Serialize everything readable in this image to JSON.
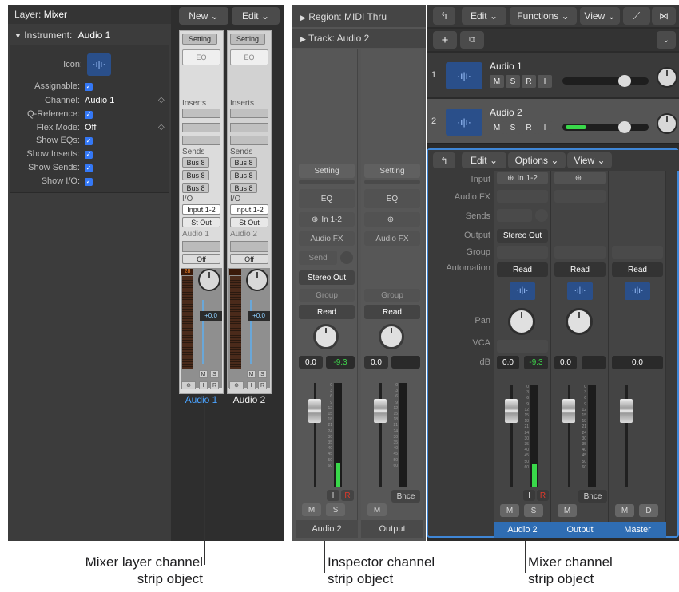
{
  "inspector_left": {
    "layer_label": "Layer:",
    "layer_value": "Mixer",
    "instrument_label": "Instrument:",
    "instrument_value": "Audio 1",
    "icon_label": "Icon:",
    "props": [
      {
        "label": "Assignable:",
        "value": "✓"
      },
      {
        "label": "Channel:",
        "value": "Audio 1"
      },
      {
        "label": "Q-Reference:",
        "value": "✓"
      },
      {
        "label": "Flex Mode:",
        "value": "Off"
      },
      {
        "label": "Show EQs:",
        "value": "✓"
      },
      {
        "label": "Show Inserts:",
        "value": "✓"
      },
      {
        "label": "Show Sends:",
        "value": "✓"
      },
      {
        "label": "Show I/O:",
        "value": "✓"
      }
    ]
  },
  "env_toolbar": {
    "new": "New",
    "edit": "Edit"
  },
  "env_strips": [
    {
      "setting": "Setting",
      "eq": "EQ",
      "inserts": "Inserts",
      "sends": "Sends",
      "bus": [
        "Bus 8",
        "Bus 8",
        "Bus 8"
      ],
      "io": "I/O",
      "input": "Input 1-2",
      "output": "St Out",
      "name_small": "Audio 1",
      "off": "Off",
      "peak": "28",
      "vol": "+0.0",
      "name": "Audio 1"
    },
    {
      "setting": "Setting",
      "eq": "EQ",
      "inserts": "Inserts",
      "sends": "Sends",
      "bus": [
        "Bus 8",
        "Bus 8",
        "Bus 8"
      ],
      "io": "I/O",
      "input": "Input 1-2",
      "output": "St Out",
      "name_small": "Audio 2",
      "off": "Off",
      "peak": "",
      "vol": "+0.0",
      "name": "Audio 2"
    }
  ],
  "env_small_buttons": [
    "M",
    "S",
    "I",
    "R"
  ],
  "inspector_right": {
    "region_label": "Region:",
    "region_value": "MIDI Thru",
    "track_label": "Track:",
    "track_value": "Audio 2",
    "strips": [
      {
        "setting": "Setting",
        "eq": "EQ",
        "input": "In 1-2",
        "audiofx": "Audio FX",
        "send": "Send",
        "output": "Stereo Out",
        "group": "Group",
        "read": "Read",
        "vol": "0.0",
        "peak": "-9.3",
        "i": "I",
        "r": "R",
        "m": "M",
        "s": "S",
        "name": "Audio 2"
      },
      {
        "setting": "Setting",
        "eq": "EQ",
        "input": "",
        "audiofx": "Audio FX",
        "send": "",
        "output": "",
        "group": "Group",
        "read": "Read",
        "vol": "0.0",
        "peak": "",
        "i": "",
        "r": "",
        "m": "M",
        "s": "",
        "bnce": "Bnce",
        "name": "Output"
      }
    ]
  },
  "main_toolbar": {
    "edit": "Edit",
    "functions": "Functions",
    "view": "View"
  },
  "tracks": [
    {
      "num": "1",
      "name": "Audio 1",
      "btns": [
        "M",
        "S",
        "R",
        "I"
      ]
    },
    {
      "num": "2",
      "name": "Audio 2",
      "btns": [
        "M",
        "S",
        "R",
        "I"
      ]
    }
  ],
  "mixer": {
    "menus": {
      "edit": "Edit",
      "options": "Options",
      "view": "View"
    },
    "row_labels": [
      "Input",
      "Audio FX",
      "Sends",
      "Output",
      "Group",
      "Automation",
      "Pan",
      "VCA",
      "dB"
    ],
    "strips": [
      {
        "input": "In 1-2",
        "output": "Stereo Out",
        "read": "Read",
        "vol": "0.0",
        "peak": "-9.3",
        "i": "I",
        "r": "R",
        "m": "M",
        "s": "S",
        "name": "Audio 2"
      },
      {
        "input": "",
        "output": "",
        "read": "Read",
        "vol": "0.0",
        "peak": "",
        "bnce": "Bnce",
        "m": "M",
        "name": "Output"
      },
      {
        "read": "Read",
        "vol": "0.0",
        "m": "M",
        "d": "D",
        "name": "Master"
      }
    ]
  },
  "scale_ticks": [
    "0",
    "3",
    "6",
    "9",
    "12",
    "15",
    "18",
    "21",
    "24",
    "30",
    "35",
    "40",
    "45",
    "50",
    "60"
  ],
  "captions": {
    "left": [
      "Mixer layer channel",
      "strip object"
    ],
    "mid": [
      "Inspector channel",
      "strip object"
    ],
    "right": [
      "Mixer channel",
      "strip object"
    ]
  },
  "colors": {
    "accent": "#3478f6",
    "meter_green": "#39d84a",
    "peak_red": "#e0392b",
    "selected_strip": "#2f6db3"
  }
}
